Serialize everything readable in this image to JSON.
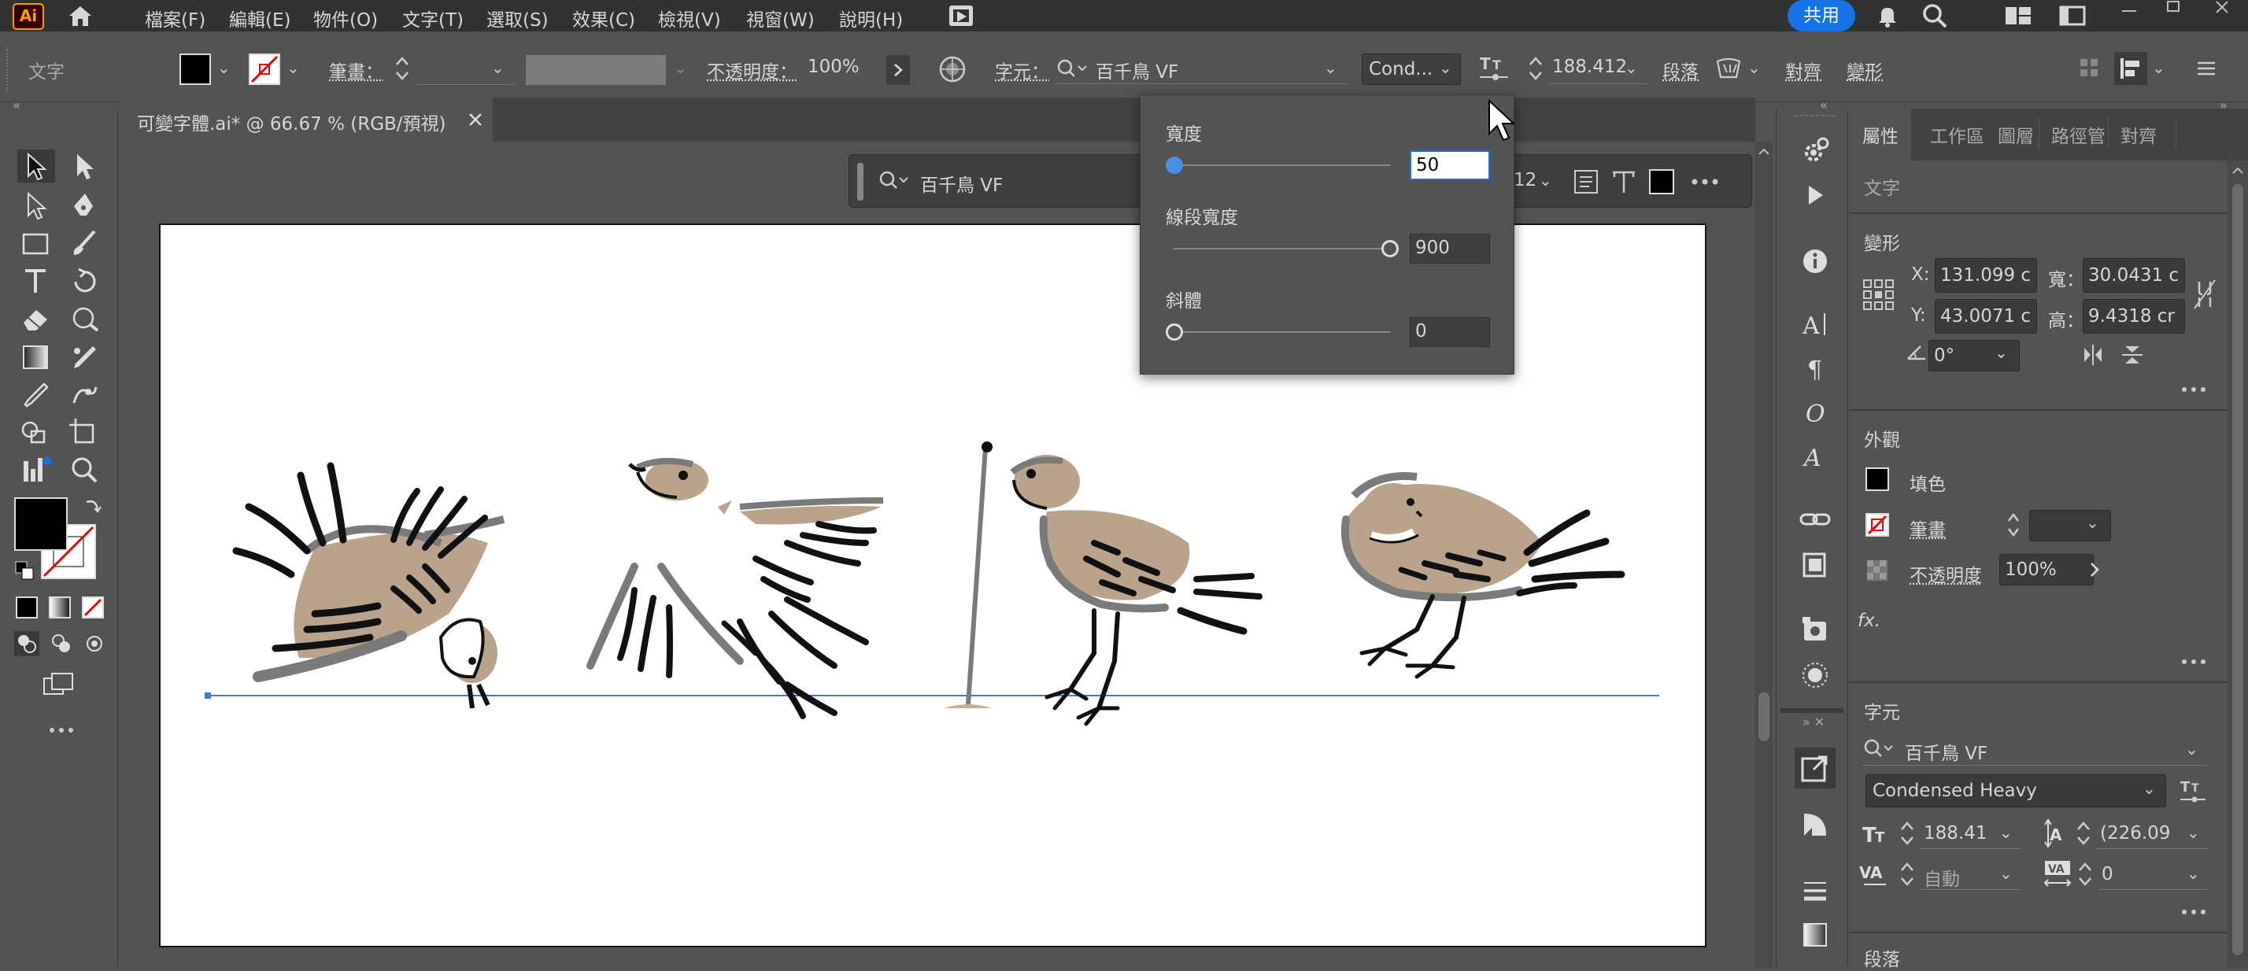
{
  "app": {
    "logo": "Ai",
    "share_label": "共用"
  },
  "menu": [
    "檔案(F)",
    "編輯(E)",
    "物件(O)",
    "文字(T)",
    "選取(S)",
    "效果(C)",
    "檢視(V)",
    "視窗(W)",
    "說明(H)"
  ],
  "control": {
    "tool_label": "文字",
    "stroke_label": "筆畫：",
    "opacity_label": "不透明度：",
    "opacity_value": "100%",
    "char_label": "字元：",
    "font_name": "百千鳥 VF",
    "font_style": "Cond...",
    "font_size": "188.412",
    "para_label": "段落",
    "align_label": "對齊",
    "shape_label": "變形"
  },
  "document": {
    "tab_title": "可變字體.ai* @ 66.67 % (RGB/預視)"
  },
  "float_bar": {
    "font_name": "百千鳥 VF",
    "size_partial": "12"
  },
  "variable_popup": {
    "width_label": "寬度",
    "width_value": "50",
    "weight_label": "線段寬度",
    "weight_value": "900",
    "slant_label": "斜體",
    "slant_value": "0",
    "width_pos": 0.0,
    "weight_pos": 1.0,
    "slant_pos": 0.0
  },
  "props": {
    "tabs": [
      "屬性",
      "工作區",
      "圖層",
      "路徑管",
      "對齊"
    ],
    "section_title": "文字",
    "transform": {
      "title": "變形",
      "x_label": "X:",
      "x_value": "131.099 c",
      "y_label": "Y:",
      "y_value": "43.0071 c",
      "w_label": "寬：",
      "w_value": "30.0431 c",
      "h_label": "高：",
      "h_value": "9.4318 cr",
      "angle_value": "0°"
    },
    "appearance": {
      "title": "外觀",
      "fill_label": "填色",
      "stroke_label": "筆畫",
      "opacity_label": "不透明度",
      "opacity_value": "100%",
      "fx_label": "fx."
    },
    "character": {
      "title": "字元",
      "font_name": "百千鳥 VF",
      "font_style": "Condensed Heavy",
      "size_value": "188.41",
      "leading_value": "(226.09",
      "kerning_value": "自動",
      "tracking_value": "0"
    },
    "paragraph_title": "段落"
  },
  "colors": {
    "bg": "#535353",
    "panel": "#535353",
    "dark_panel": "#323232",
    "accent": "#1473e6",
    "bird_tan": "#b9a38c",
    "bird_gray": "#7a7a7a"
  }
}
